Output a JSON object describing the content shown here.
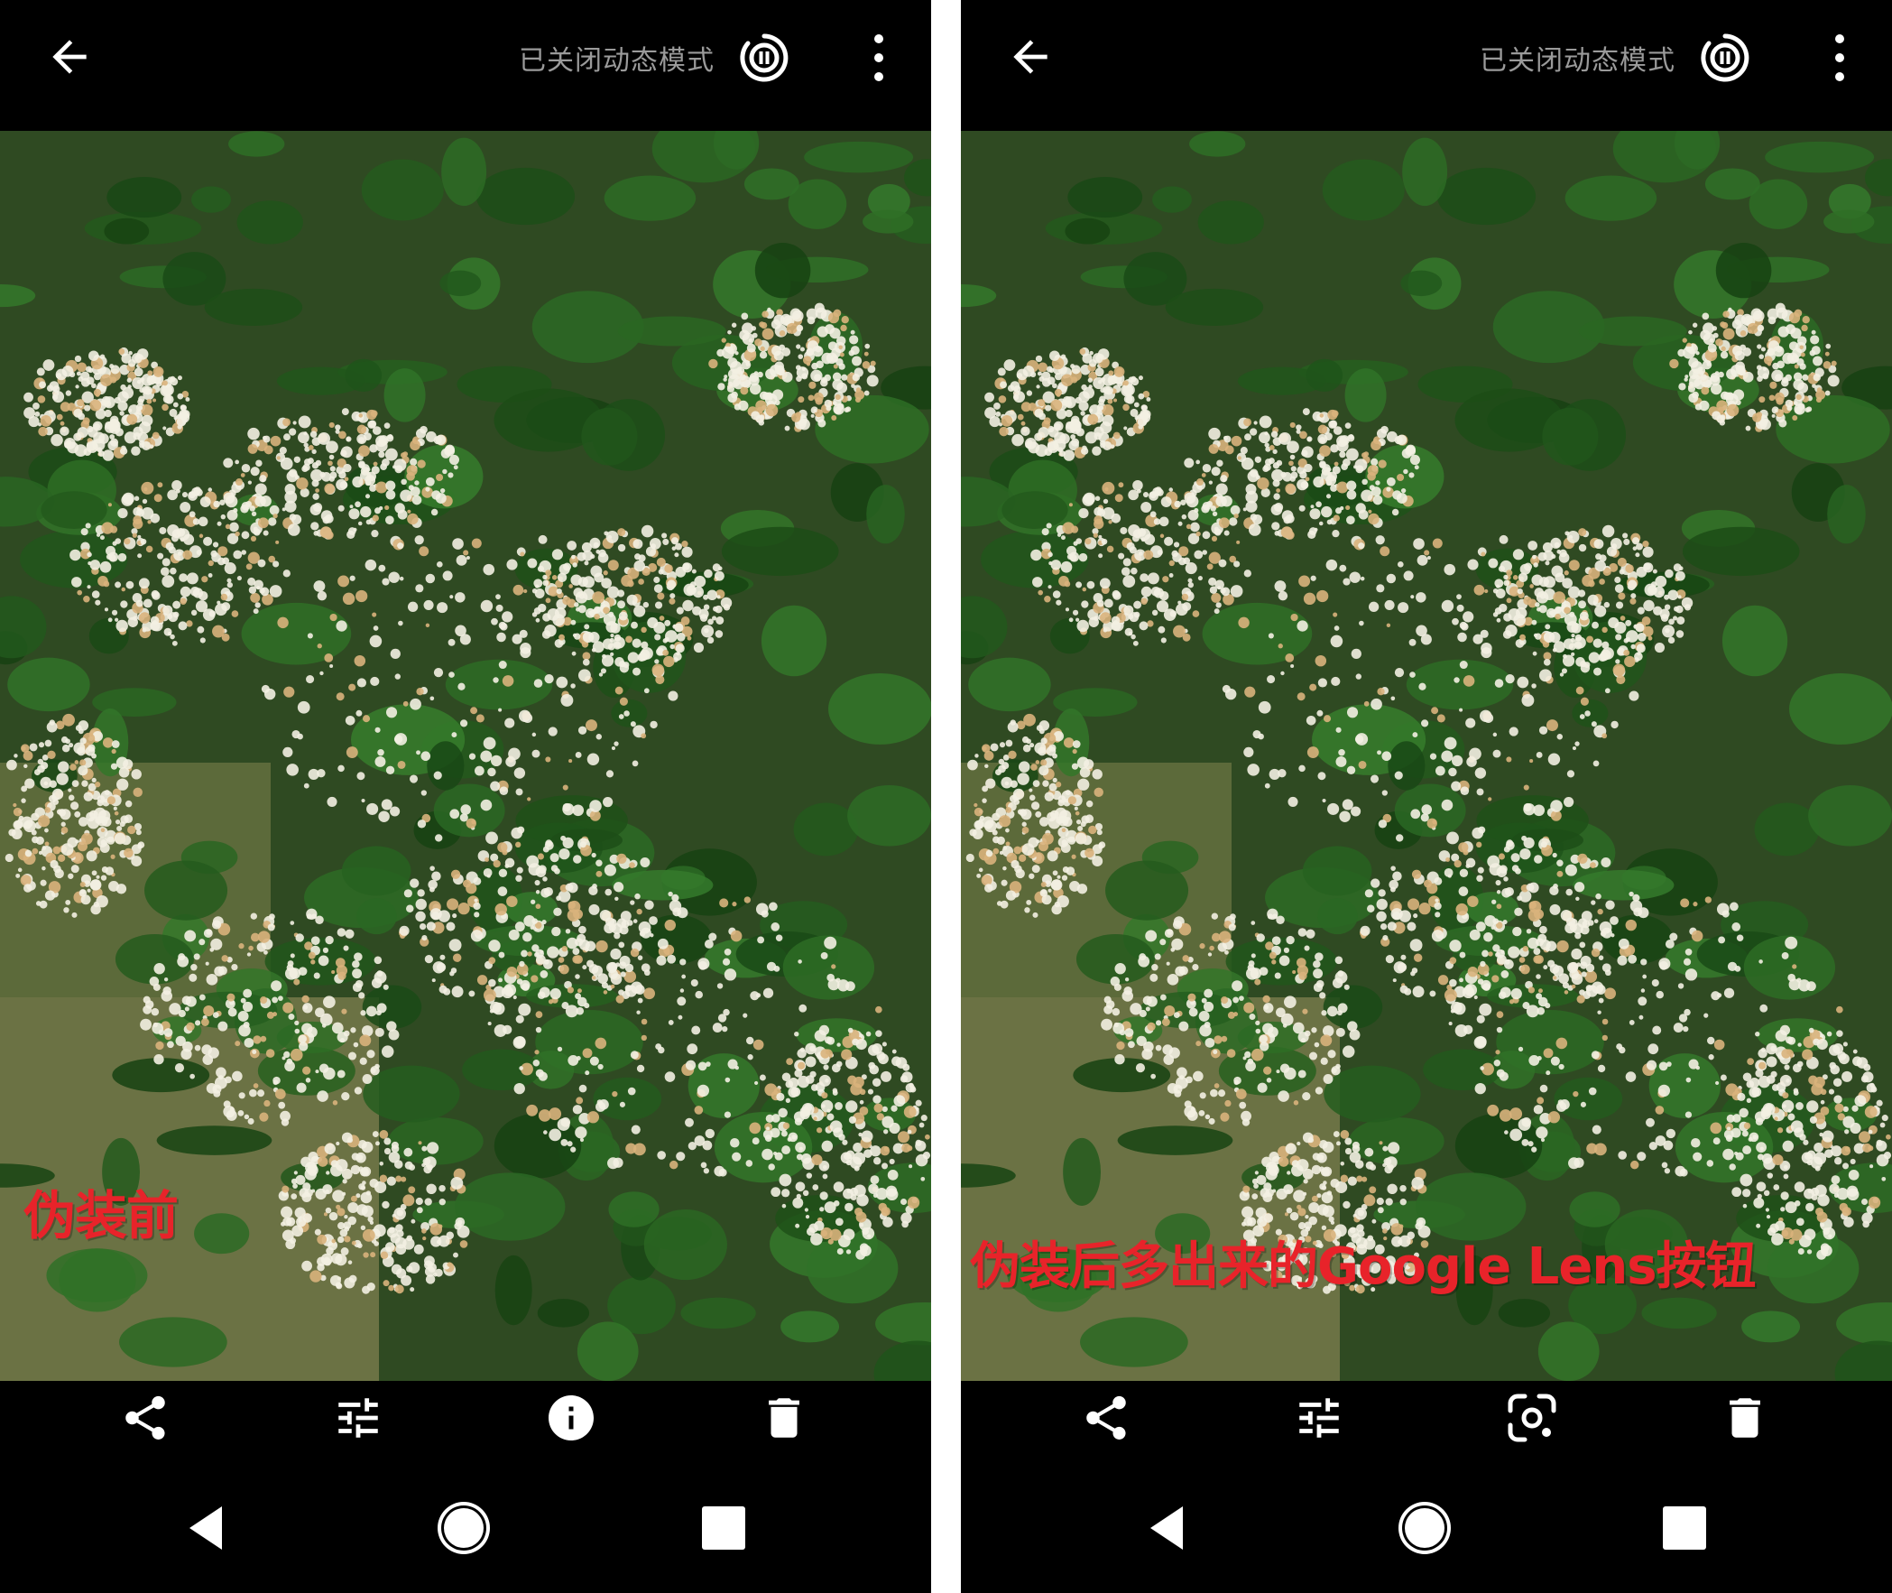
{
  "panels": [
    {
      "id": "left",
      "top_bar": {
        "back_icon": "arrow-left-icon",
        "motion_status": "已关闭动态模式",
        "motion_icon": "motion-off-icon",
        "more_icon": "more-vertical-icon"
      },
      "annotation": "伪装前",
      "actions": [
        "share-icon",
        "edit-adjust-icon",
        "info-icon",
        "delete-icon"
      ]
    },
    {
      "id": "right",
      "top_bar": {
        "back_icon": "arrow-left-icon",
        "motion_status": "已关闭动态模式",
        "motion_icon": "motion-off-icon",
        "more_icon": "more-vertical-icon"
      },
      "annotation": "伪装后多出来的Google Lens按钮",
      "actions": [
        "share-icon",
        "edit-adjust-icon",
        "google-lens-icon",
        "delete-icon"
      ]
    }
  ],
  "nav_bar": [
    "back-triangle-icon",
    "home-circle-icon",
    "recents-square-icon"
  ],
  "colors": {
    "bar_background": "#000000",
    "status_text": "#9a9a9a",
    "annotation_red": "#e8232a",
    "foliage": "#2f4a22",
    "flower": "#f3efe2"
  }
}
